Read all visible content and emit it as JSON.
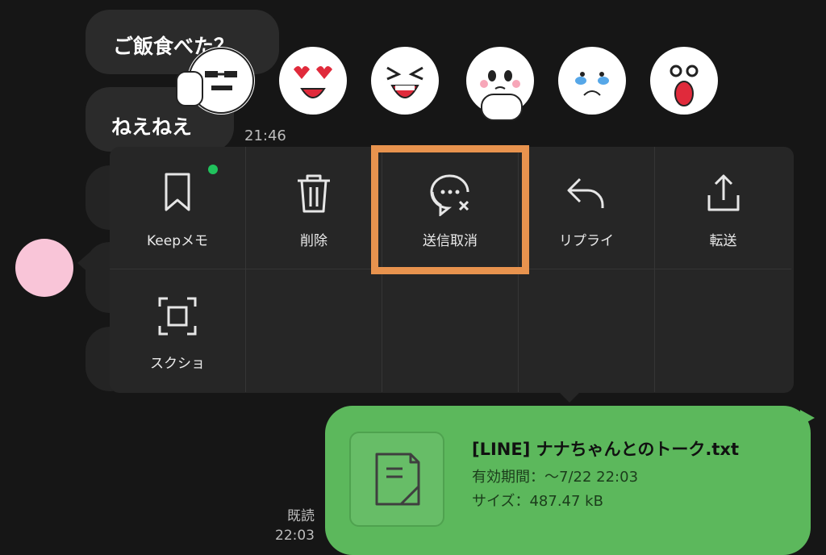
{
  "messages": [
    {
      "text": "ご飯食べた？"
    },
    {
      "text": "ねえねえ"
    }
  ],
  "time_received": "21:46",
  "reactions": [
    {
      "name": "thumbs-up-face"
    },
    {
      "name": "heart-eyes-face"
    },
    {
      "name": "laughing-face"
    },
    {
      "name": "touched-face"
    },
    {
      "name": "crying-face"
    },
    {
      "name": "shocked-face"
    }
  ],
  "menu": {
    "items": [
      {
        "label": "Keepメモ",
        "icon": "bookmark-icon"
      },
      {
        "label": "削除",
        "icon": "trash-icon"
      },
      {
        "label": "送信取消",
        "icon": "unsend-icon"
      },
      {
        "label": "リプライ",
        "icon": "reply-icon"
      },
      {
        "label": "転送",
        "icon": "share-icon"
      },
      {
        "label": "スクショ",
        "icon": "screenshot-icon"
      }
    ],
    "highlight_color": "#e8934e"
  },
  "file_message": {
    "name": "[LINE] ナナちゃんとのトーク.txt",
    "expiry": "有効期間：～7/22 22:03",
    "size": "サイズ：487.47 kB",
    "bubble_color": "#5cb85c"
  },
  "read_status": "既読",
  "time_sent": "22:03"
}
